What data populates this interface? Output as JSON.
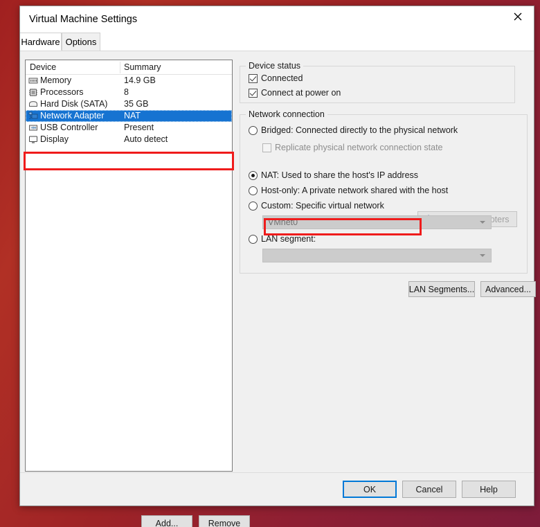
{
  "window": {
    "title": "Virtual Machine Settings",
    "close_icon": "close-icon"
  },
  "tabs": [
    {
      "label": "Hardware",
      "active": true
    },
    {
      "label": "Options",
      "active": false
    }
  ],
  "device_list": {
    "columns": {
      "device": "Device",
      "summary": "Summary"
    },
    "rows": [
      {
        "icon": "memory-icon",
        "name": "Memory",
        "summary": "14.9 GB",
        "selected": false
      },
      {
        "icon": "processor-icon",
        "name": "Processors",
        "summary": "8",
        "selected": false
      },
      {
        "icon": "hard-disk-icon",
        "name": "Hard Disk (SATA)",
        "summary": "35 GB",
        "selected": false
      },
      {
        "icon": "network-adapter-icon",
        "name": "Network Adapter",
        "summary": "NAT",
        "selected": true
      },
      {
        "icon": "usb-controller-icon",
        "name": "USB Controller",
        "summary": "Present",
        "selected": false
      },
      {
        "icon": "display-icon",
        "name": "Display",
        "summary": "Auto detect",
        "selected": false
      }
    ],
    "add_label": "Add...",
    "remove_label": "Remove"
  },
  "device_status": {
    "legend": "Device status",
    "checkboxes": [
      {
        "label": "Connected",
        "checked": true
      },
      {
        "label": "Connect at power on",
        "checked": true
      }
    ]
  },
  "network_connection": {
    "legend": "Network connection",
    "options": [
      {
        "label": "Bridged: Connected directly to the physical network",
        "selected": false
      },
      {
        "label": "NAT: Used to share the host's IP address",
        "selected": true
      },
      {
        "label": "Host-only: A private network shared with the host",
        "selected": false
      },
      {
        "label": "Custom: Specific virtual network",
        "selected": false
      },
      {
        "label": "LAN segment:",
        "selected": false
      }
    ],
    "replicate_checkbox": {
      "label": "Replicate physical network connection state",
      "checked": false,
      "disabled": true
    },
    "configure_adapters_label": "Configure Adapters",
    "configure_adapters_icon": "shield-icon",
    "custom_network_value": "VMnet0",
    "lan_segment_value": "",
    "lan_segments_label": "LAN Segments...",
    "advanced_label": "Advanced..."
  },
  "footer": {
    "ok_label": "OK",
    "cancel_label": "Cancel",
    "help_label": "Help"
  },
  "colors": {
    "selection_blue": "#1673d1",
    "annotation_red": "#ef1b1b",
    "focus_blue": "#0078d7",
    "desktop_red": "#a02020"
  }
}
